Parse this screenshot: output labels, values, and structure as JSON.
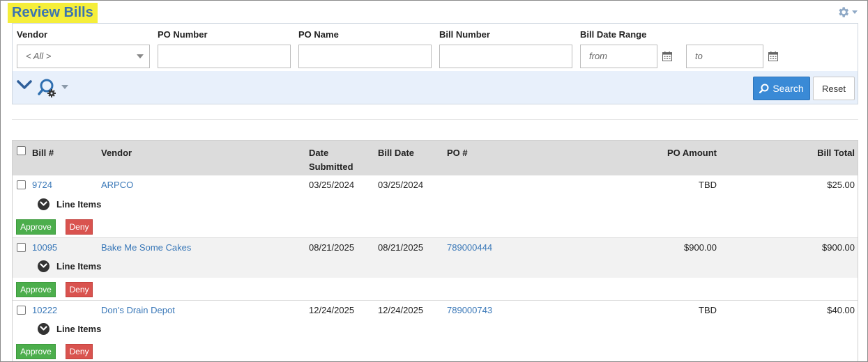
{
  "page": {
    "title": "Review Bills"
  },
  "filters": {
    "vendor_label": "Vendor",
    "vendor_value": "< All >",
    "po_number_label": "PO Number",
    "po_number_value": "",
    "po_name_label": "PO Name",
    "po_name_value": "",
    "bill_number_label": "Bill Number",
    "bill_number_value": "",
    "date_range_label": "Bill Date Range",
    "date_from_placeholder": "from",
    "date_to_placeholder": "to",
    "search_label": "Search",
    "reset_label": "Reset"
  },
  "table": {
    "columns": {
      "bill": "Bill #",
      "vendor": "Vendor",
      "date_submitted_1": "Date",
      "date_submitted_2": "Submitted",
      "bill_date": "Bill Date",
      "po": "PO #",
      "po_amount": "PO Amount",
      "bill_total": "Bill Total"
    },
    "line_items_label": "Line Items",
    "approve_label": "Approve",
    "deny_label": "Deny",
    "rows": [
      {
        "bill": "9724",
        "vendor": "ARPCO",
        "date_submitted": "03/25/2024",
        "bill_date": "03/25/2024",
        "po": "",
        "po_amount": "TBD",
        "bill_total": "$25.00"
      },
      {
        "bill": "10095",
        "vendor": "Bake Me Some Cakes",
        "date_submitted": "08/21/2025",
        "bill_date": "08/21/2025",
        "po": "789000444",
        "po_amount": "$900.00",
        "bill_total": "$900.00"
      },
      {
        "bill": "10222",
        "vendor": "Don's Drain Depot",
        "date_submitted": "12/24/2025",
        "bill_date": "12/24/2025",
        "po": "789000743",
        "po_amount": "TBD",
        "bill_total": "$40.00"
      }
    ]
  },
  "colors": {
    "title_highlight": "#f5ee3a",
    "title_text": "#3a73b0",
    "link": "#3a78b8",
    "primary_button": "#3a8ad6",
    "approve": "#4cae4c",
    "deny": "#d9534f",
    "filter_bar": "#e8f0fb"
  },
  "icons": {
    "settings": "gear-icon",
    "collapse": "chevron-down-icon",
    "advanced_search": "search-gear-icon",
    "calendar": "calendar-icon",
    "search_button": "search-icon",
    "line_items_toggle": "chevron-down-circle-icon"
  }
}
